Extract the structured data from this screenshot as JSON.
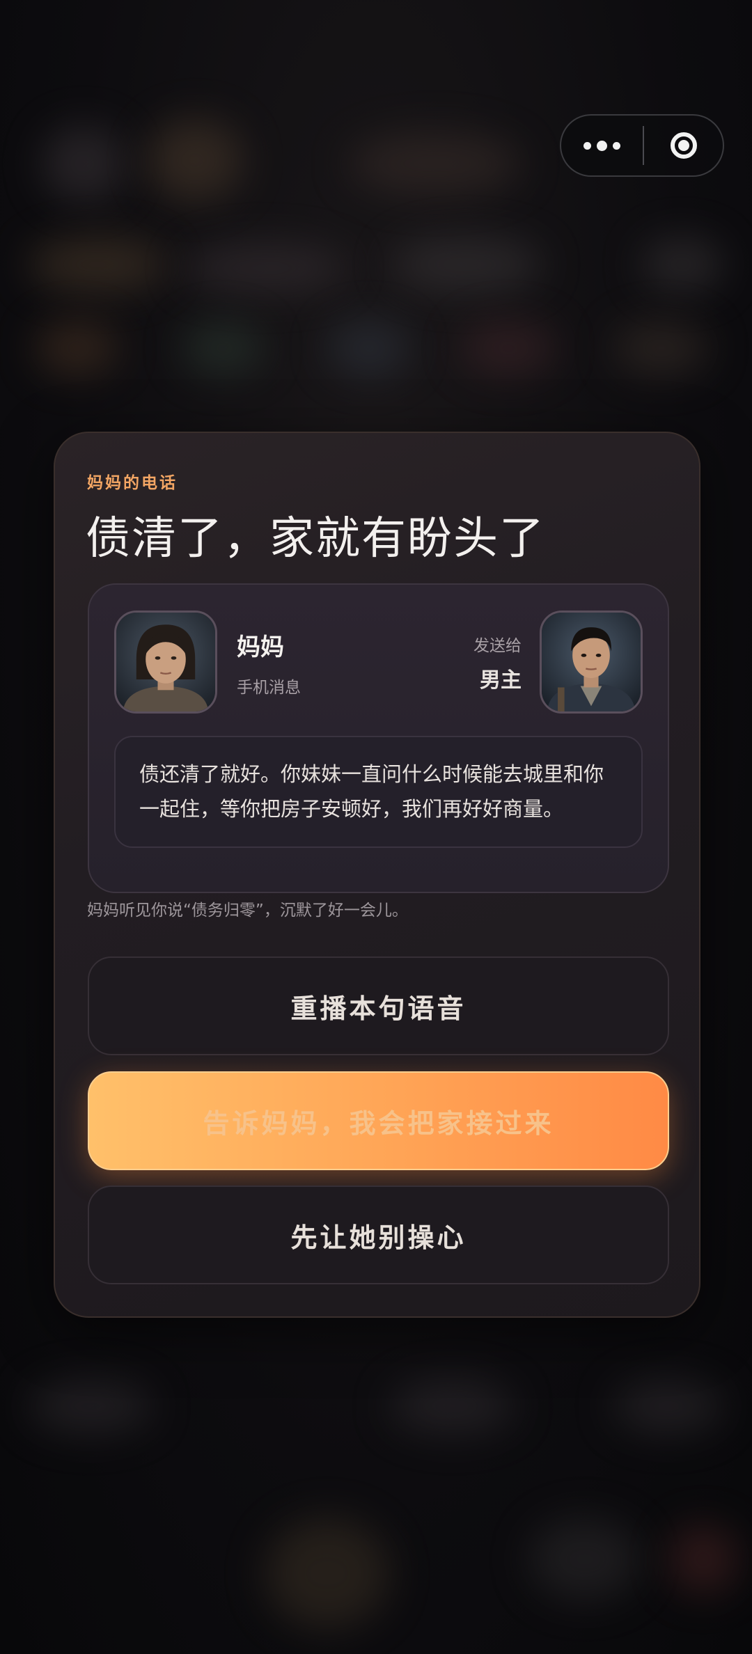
{
  "capsule": {
    "more_icon": "more-dots-icon",
    "close_icon": "target-circle-icon"
  },
  "modal": {
    "eyebrow": "妈妈的电话",
    "title": "债清了，家就有盼头了",
    "sender": {
      "name": "妈妈",
      "subtitle": "手机消息",
      "avatar_icon": "mother-avatar"
    },
    "receiver": {
      "send_to_label": "发送给",
      "name": "男主",
      "avatar_icon": "male-lead-avatar"
    },
    "message": "债还清了就好。你妹妹一直问什么时候能去城里和你一起住，等你把房子安顿好，我们再好好商量。",
    "hint": "妈妈听见你说“债务归零”，沉默了好一会儿。",
    "buttons": {
      "replay": "重播本句语音",
      "tell": "告诉妈妈，我会把家接过来",
      "worry": "先让她别操心"
    }
  },
  "colors": {
    "accent": "#f3a664",
    "primary_button_start": "#ffc06a",
    "primary_button_end": "#ff8a45"
  }
}
